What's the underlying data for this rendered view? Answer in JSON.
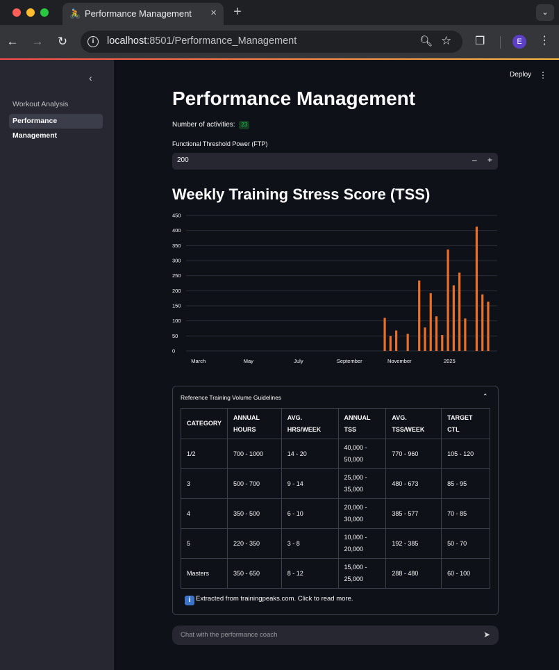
{
  "browser": {
    "tab_title": "Performance Management",
    "tab_close": "×",
    "new_tab": "+",
    "url_host": "localhost",
    "url_path": ":8501/Performance_Management",
    "avatar_letter": "E"
  },
  "sidebar": {
    "items": [
      {
        "label": "Workout Analysis",
        "active": false
      },
      {
        "label": "Performance Management",
        "active": true
      }
    ]
  },
  "header": {
    "deploy_label": "Deploy"
  },
  "main": {
    "title": "Performance Management",
    "activities_label": "Number of activities:",
    "activities_count": "23",
    "ftp_label": "Functional Threshold Power (FTP)",
    "ftp_value": "200",
    "ftp_minus": "–",
    "ftp_plus": "+",
    "chart_title": "Weekly Training Stress Score (TSS)"
  },
  "chart_data": {
    "type": "bar",
    "title": "Weekly Training Stress Score (TSS)",
    "ylim": [
      0,
      450
    ],
    "yticks": [
      "0",
      "50",
      "100",
      "150",
      "200",
      "250",
      "300",
      "350",
      "400",
      "450"
    ],
    "xticks": [
      "March",
      "May",
      "July",
      "September",
      "November",
      "2025"
    ],
    "bar_color": "#e8702a",
    "values": [
      {
        "x": "2024-10-14",
        "y": 110
      },
      {
        "x": "2024-10-21",
        "y": 50
      },
      {
        "x": "2024-10-28",
        "y": 68
      },
      {
        "x": "2024-11-11",
        "y": 57
      },
      {
        "x": "2024-11-25",
        "y": 234
      },
      {
        "x": "2024-12-02",
        "y": 78
      },
      {
        "x": "2024-12-09",
        "y": 192
      },
      {
        "x": "2024-12-16",
        "y": 115
      },
      {
        "x": "2024-12-23",
        "y": 53
      },
      {
        "x": "2024-12-30",
        "y": 337
      },
      {
        "x": "2025-01-06",
        "y": 218
      },
      {
        "x": "2025-01-13",
        "y": 260
      },
      {
        "x": "2025-01-20",
        "y": 108
      },
      {
        "x": "2025-02-03",
        "y": 413
      },
      {
        "x": "2025-02-10",
        "y": 188
      },
      {
        "x": "2025-02-17",
        "y": 164
      }
    ]
  },
  "expander": {
    "title": "Reference Training Volume Guidelines",
    "headers": [
      [
        "CATEGORY"
      ],
      [
        "ANNUAL",
        "HOURS"
      ],
      [
        "AVG.",
        "HRS/WEEK"
      ],
      [
        "ANNUAL",
        "TSS"
      ],
      [
        "AVG.",
        "TSS/WEEK"
      ],
      [
        "TARGET",
        "CTL"
      ]
    ],
    "rows": [
      [
        "1/2",
        "700 - 1000",
        "14 - 20",
        [
          "40,000 -",
          "50,000"
        ],
        "770 - 960",
        "105 - 120"
      ],
      [
        "3",
        "500 - 700",
        "9 - 14",
        [
          "25,000 -",
          "35,000"
        ],
        "480 - 673",
        "85 - 95"
      ],
      [
        "4",
        "350 - 500",
        "6 - 10",
        [
          "20,000 -",
          "30,000"
        ],
        "385 - 577",
        "70 - 85"
      ],
      [
        "5",
        "220 - 350",
        "3 - 8",
        [
          "10,000 -",
          "20,000"
        ],
        "192 - 385",
        "50 - 70"
      ],
      [
        "Masters",
        "350 - 650",
        "8 - 12",
        [
          "15,000 -",
          "25,000"
        ],
        "288 - 480",
        "60 - 100"
      ]
    ],
    "note": "Extracted from trainingpeaks.com. Click to read more."
  },
  "chat": {
    "placeholder": "Chat with the performance coach"
  }
}
